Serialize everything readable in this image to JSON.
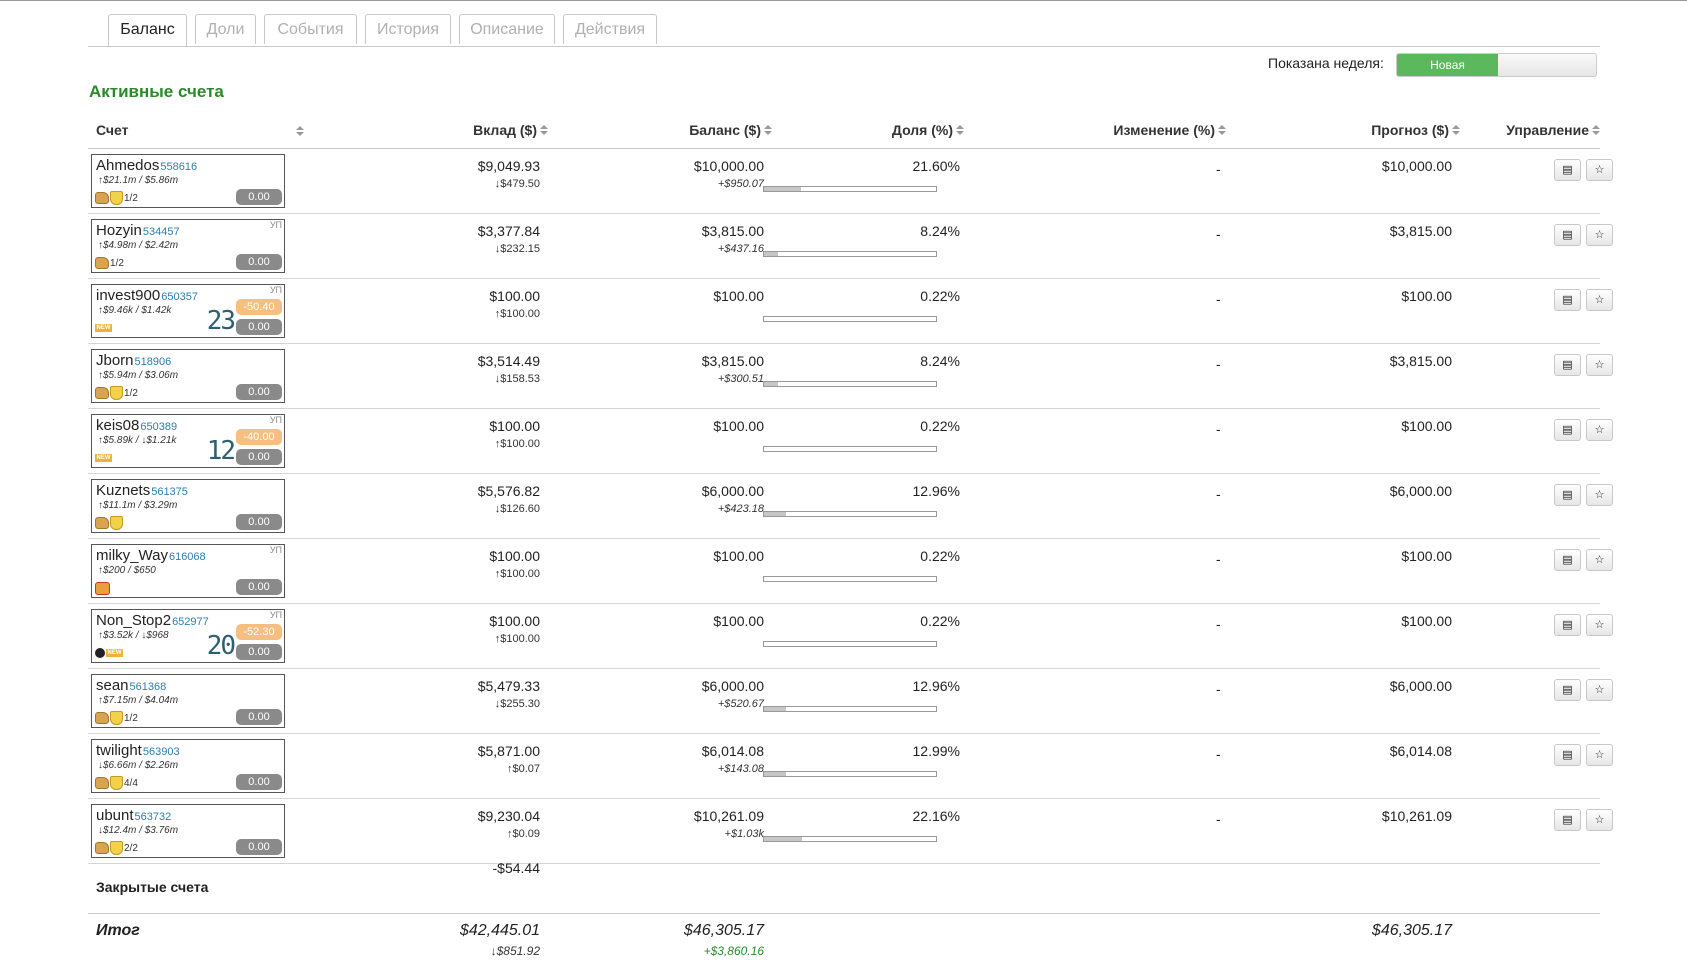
{
  "tabs": [
    "Баланс",
    "Доли",
    "События",
    "История",
    "Описание",
    "Действия"
  ],
  "week": {
    "label": "Показана неделя:",
    "active": "Новая"
  },
  "section_title": "Активные счета",
  "columns": {
    "account": "Счет",
    "deposit": "Вклад ($)",
    "balance": "Баланс ($)",
    "share": "Доля (%)",
    "change": "Изменение (%)",
    "forecast": "Прогноз ($)",
    "control": "Управление"
  },
  "rows": [
    {
      "name": "Ahmedos",
      "id": "558616",
      "stats": "↑$21.1m / $5.86m",
      "badges": [
        "thumb",
        "shield"
      ],
      "frac": "1/2",
      "up": "",
      "pill": "0.00",
      "pill2": "",
      "big": "",
      "deposit": "$9,049.93",
      "deposit_sub": "↓$479.50",
      "balance": "$10,000.00",
      "balance_sub": "+$950.07",
      "share": "21.60%",
      "share_pct": 21.6,
      "change": "-",
      "forecast": "$10,000.00"
    },
    {
      "name": "Hozyin",
      "id": "534457",
      "stats": "↑$4.98m / $2.42m",
      "badges": [
        "thumb"
      ],
      "frac": "1/2",
      "up": "УП",
      "pill": "0.00",
      "pill2": "",
      "big": "",
      "deposit": "$3,377.84",
      "deposit_sub": "↓$232.15",
      "balance": "$3,815.00",
      "balance_sub": "+$437.16",
      "share": "8.24%",
      "share_pct": 8.24,
      "change": "-",
      "forecast": "$3,815.00"
    },
    {
      "name": "invest900",
      "id": "650357",
      "stats": "↑$9.46k / $1.42k",
      "badges": [
        "new"
      ],
      "frac": "",
      "up": "УП",
      "pill": "0.00",
      "pill2": "-50.40",
      "big": "23",
      "deposit": "$100.00",
      "deposit_sub": "↑$100.00",
      "balance": "$100.00",
      "balance_sub": "",
      "share": "0.22%",
      "share_pct": 0.22,
      "change": "-",
      "forecast": "$100.00"
    },
    {
      "name": "Jborn",
      "id": "518906",
      "stats": "↑$5.94m / $3.06m",
      "badges": [
        "thumb",
        "shield"
      ],
      "frac": "1/2",
      "up": "",
      "pill": "0.00",
      "pill2": "",
      "big": "",
      "deposit": "$3,514.49",
      "deposit_sub": "↓$158.53",
      "balance": "$3,815.00",
      "balance_sub": "+$300.51",
      "share": "8.24%",
      "share_pct": 8.24,
      "change": "-",
      "forecast": "$3,815.00"
    },
    {
      "name": "keis08",
      "id": "650389",
      "stats": "↑$5.89k / ↓$1.21k",
      "badges": [
        "new"
      ],
      "frac": "",
      "up": "УП",
      "pill": "0.00",
      "pill2": "-40.00",
      "big": "12",
      "deposit": "$100.00",
      "deposit_sub": "↑$100.00",
      "balance": "$100.00",
      "balance_sub": "",
      "share": "0.22%",
      "share_pct": 0.22,
      "change": "-",
      "forecast": "$100.00"
    },
    {
      "name": "Kuznets",
      "id": "561375",
      "stats": "↑$11.1m / $3.29m",
      "badges": [
        "thumb",
        "shield"
      ],
      "frac": "",
      "up": "",
      "pill": "0.00",
      "pill2": "",
      "big": "",
      "deposit": "$5,576.82",
      "deposit_sub": "↓$126.60",
      "balance": "$6,000.00",
      "balance_sub": "+$423.18",
      "share": "12.96%",
      "share_pct": 12.96,
      "change": "-",
      "forecast": "$6,000.00"
    },
    {
      "name": "milky_Way",
      "id": "616068",
      "stats": "↑$200 / $650",
      "badges": [
        "cart"
      ],
      "frac": "",
      "up": "УП",
      "pill": "0.00",
      "pill2": "",
      "big": "",
      "deposit": "$100.00",
      "deposit_sub": "↑$100.00",
      "balance": "$100.00",
      "balance_sub": "",
      "share": "0.22%",
      "share_pct": 0.22,
      "change": "-",
      "forecast": "$100.00"
    },
    {
      "name": "Non_Stop2",
      "id": "652977",
      "stats": "↑$3.52k / ↓$968",
      "badges": [
        "bomb",
        "new"
      ],
      "frac": "",
      "up": "УП",
      "pill": "0.00",
      "pill2": "-52.30",
      "big": "20",
      "deposit": "$100.00",
      "deposit_sub": "↑$100.00",
      "balance": "$100.00",
      "balance_sub": "",
      "share": "0.22%",
      "share_pct": 0.22,
      "change": "-",
      "forecast": "$100.00"
    },
    {
      "name": "sean",
      "id": "561368",
      "stats": "↑$7.15m / $4.04m",
      "badges": [
        "thumb",
        "shield"
      ],
      "frac": "1/2",
      "up": "",
      "pill": "0.00",
      "pill2": "",
      "big": "",
      "deposit": "$5,479.33",
      "deposit_sub": "↓$255.30",
      "balance": "$6,000.00",
      "balance_sub": "+$520.67",
      "share": "12.96%",
      "share_pct": 12.96,
      "change": "-",
      "forecast": "$6,000.00"
    },
    {
      "name": "twilight",
      "id": "563903",
      "stats": "↓$6.66m / $2.26m",
      "badges": [
        "thumb",
        "shield"
      ],
      "frac": "4/4",
      "up": "",
      "pill": "0.00",
      "pill2": "",
      "big": "",
      "deposit": "$5,871.00",
      "deposit_sub": "↑$0.07",
      "balance": "$6,014.08",
      "balance_sub": "+$143.08",
      "share": "12.99%",
      "share_pct": 12.99,
      "change": "-",
      "forecast": "$6,014.08"
    },
    {
      "name": "ubunt",
      "id": "563732",
      "stats": "↓$12.4m / $3.76m",
      "badges": [
        "thumb",
        "shield"
      ],
      "frac": "2/2",
      "up": "",
      "pill": "0.00",
      "pill2": "",
      "big": "",
      "deposit": "$9,230.04",
      "deposit_sub": "↑$0.09",
      "balance": "$10,261.09",
      "balance_sub": "+$1.03k",
      "share": "22.16%",
      "share_pct": 22.16,
      "change": "-",
      "forecast": "$10,261.09"
    }
  ],
  "closed": {
    "label": "Закрытые счета",
    "deposit": "-$54.44"
  },
  "total": {
    "label": "Итог",
    "deposit": "$42,445.01",
    "deposit_sub": "↓$851.92",
    "balance": "$46,305.17",
    "balance_sub": "+$3,860.16",
    "forecast": "$46,305.17"
  },
  "colors": {
    "accent_green": "#2a8a2a",
    "toggle_green": "#5cb85c",
    "link_blue": "#2a7fae",
    "warn_orange": "#f6bf80"
  }
}
